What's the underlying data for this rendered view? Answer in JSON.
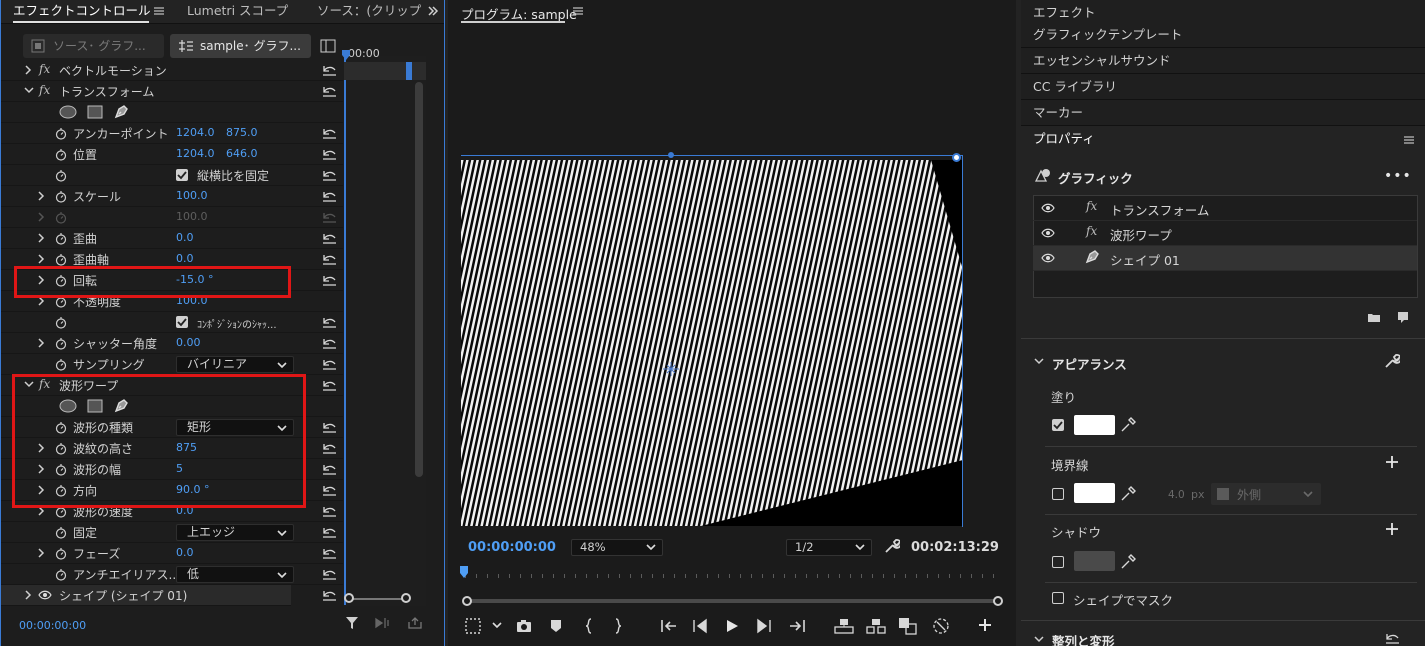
{
  "left_panel": {
    "tabs": [
      "エフェクトコントロール",
      "Lumetri スコープ",
      "ソース：(クリップな"
    ],
    "source_button": "ソース･ グラフ...",
    "sequence_button": "sample･ グラフ...",
    "timeline_time": "00:00",
    "current_time": "00:00:00:00",
    "rows": {
      "vector_motion": "ベクトルモーション",
      "transform": "トランスフォーム",
      "anchor_point": {
        "label": "アンカーポイント",
        "x": "1204.0",
        "y": "875.0"
      },
      "position": {
        "label": "位置",
        "x": "1204.0",
        "y": "646.0"
      },
      "uniform_scale": "縦横比を固定",
      "scale": {
        "label": "スケール",
        "value": "100.0"
      },
      "scale_width": {
        "value": "100.0"
      },
      "skew": {
        "label": "歪曲",
        "value": "0.0"
      },
      "skew_axis": {
        "label": "歪曲軸",
        "value": "0.0"
      },
      "rotation": {
        "label": "回転",
        "value": "-15.0 °"
      },
      "opacity": {
        "label": "不透明度",
        "value": "100.0"
      },
      "comp_shutter": "ｺﾝﾎﾟｼﾞｼｮﾝのｼｬｯ...",
      "shutter_angle": {
        "label": "シャッター角度",
        "value": "0.00"
      },
      "sampling": {
        "label": "サンプリング",
        "value": "バイリニア"
      },
      "wave_warp": "波形ワープ",
      "wave_type": {
        "label": "波形の種類",
        "value": "矩形"
      },
      "wave_height": {
        "label": "波紋の高さ",
        "value": "875"
      },
      "wave_width": {
        "label": "波形の幅",
        "value": "5"
      },
      "direction": {
        "label": "方向",
        "value": "90.0 °"
      },
      "wave_speed": {
        "label": "波形の速度",
        "value": "0.0"
      },
      "pinning": {
        "label": "固定",
        "value": "上エッジ"
      },
      "phase": {
        "label": "フェーズ",
        "value": "0.0"
      },
      "antialias": {
        "label": "アンチエイリアス...",
        "value": "低"
      },
      "shape": "シェイプ (シェイプ 01)"
    }
  },
  "program_monitor": {
    "title": "プログラム: sample",
    "current_time": "00:00:00:00",
    "zoom": "48%",
    "resolution": "1/2",
    "duration": "00:02:13:29"
  },
  "right_panel": {
    "sections": [
      "エフェクト",
      "グラフィックテンプレート",
      "エッセンシャルサウンド",
      "CC ライブラリ",
      "マーカー"
    ],
    "properties_title": "プロパティ",
    "graphic_label": "グラフィック",
    "layers": [
      "トランスフォーム",
      "波形ワープ",
      "シェイプ 01"
    ],
    "appearance": "アピアランス",
    "fill": "塗り",
    "stroke": "境界線",
    "stroke_width": "4.0",
    "stroke_unit": "px",
    "stroke_position": "外側",
    "shadow": "シャドウ",
    "mask_with_shape": "シェイプでマスク",
    "align_transform": "整列と変形"
  },
  "colors": {
    "accent_blue": "#3a7bd5",
    "value_blue": "#4f9ef5",
    "highlight_red": "#e01616"
  }
}
